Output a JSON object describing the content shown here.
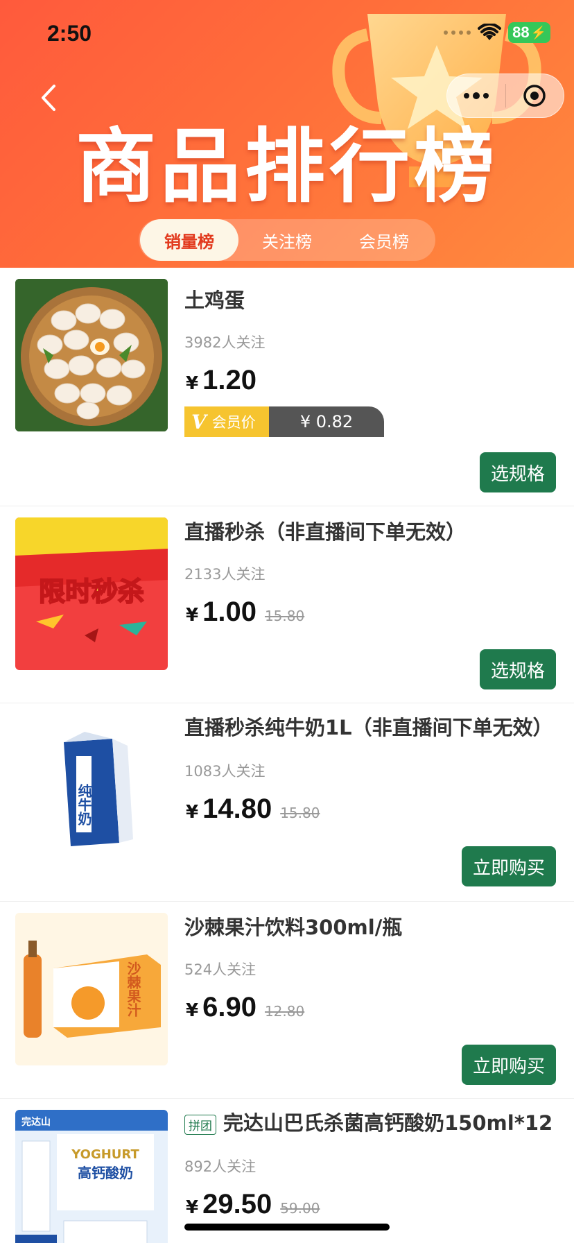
{
  "status_bar": {
    "time": "2:50",
    "battery": "88"
  },
  "header": {
    "title": "商品排行榜",
    "tabs": [
      {
        "label": "销量榜",
        "active": true
      },
      {
        "label": "关注榜",
        "active": false
      },
      {
        "label": "会员榜",
        "active": false
      }
    ]
  },
  "products": [
    {
      "name": "土鸡蛋",
      "follow": "3982人关注",
      "yen": "¥",
      "price": "1.20",
      "original": "",
      "member_label": "会员价",
      "member_v": "V",
      "member_price": "¥ 0.82",
      "button": "选规格",
      "image": "eggs-basket"
    },
    {
      "name": "直播秒杀（非直播间下单无效）",
      "follow": "2133人关注",
      "yen": "¥",
      "price": "1.00",
      "original": "15.80",
      "button": "选规格",
      "image": "flash-sale-banner",
      "image_text": "限时秒杀"
    },
    {
      "name": "直播秒杀纯牛奶1L（非直播间下单无效）",
      "follow": "1083人关注",
      "yen": "¥",
      "price": "14.80",
      "original": "15.80",
      "button": "立即购买",
      "image": "milk-carton",
      "image_text": "纯牛奶"
    },
    {
      "name": "沙棘果汁饮料300ml/瓶",
      "follow": "524人关注",
      "yen": "¥",
      "price": "6.90",
      "original": "12.80",
      "button": "立即购买",
      "image": "juice-box",
      "image_text": "沙棘果汁"
    },
    {
      "name": "完达山巴氏杀菌高钙酸奶150ml*12",
      "tag": "拼团",
      "follow": "892人关注",
      "yen": "¥",
      "price": "29.50",
      "original": "59.00",
      "image": "yoghurt-box",
      "image_text": "高钙酸奶",
      "image_brand": "完达山",
      "image_brand_en": "YOGHURT"
    }
  ],
  "colors": {
    "header": "#ff6a3a",
    "button": "#1f7a4d",
    "member_gold": "#f6c42f"
  }
}
